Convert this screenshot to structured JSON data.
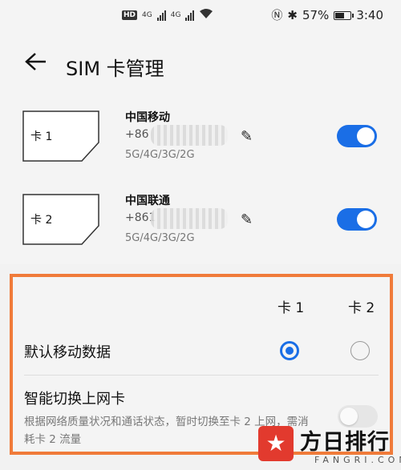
{
  "status_bar": {
    "hd": "HD",
    "sim1_network": "4G",
    "sim2_network": "4G",
    "battery": "57%",
    "time": "3:40"
  },
  "header": {
    "title": "SIM 卡管理"
  },
  "sims": [
    {
      "card_label": "卡 1",
      "carrier": "中国移动",
      "number": "+86",
      "network": "5G/4G/3G/2G",
      "enabled": true
    },
    {
      "card_label": "卡 2",
      "carrier": "中国联通",
      "number": "+861",
      "network": "5G/4G/3G/2G",
      "enabled": true
    }
  ],
  "settings": {
    "col1": "卡 1",
    "col2": "卡 2",
    "default_data_label": "默认移动数据",
    "default_data_selected": "卡 1",
    "smart_switch_label": "智能切换上网卡",
    "smart_switch_desc": "根据网络质量状况和通话状态，暂时切换至卡 2 上网，需消耗卡 2 流量",
    "smart_switch_enabled": false
  },
  "watermark": {
    "cn": "方日排行",
    "en": "FANGRI.COM"
  },
  "colors": {
    "accent": "#1a6ee6",
    "highlight_border": "#f07b3a",
    "logo_red": "#e23a2e"
  }
}
